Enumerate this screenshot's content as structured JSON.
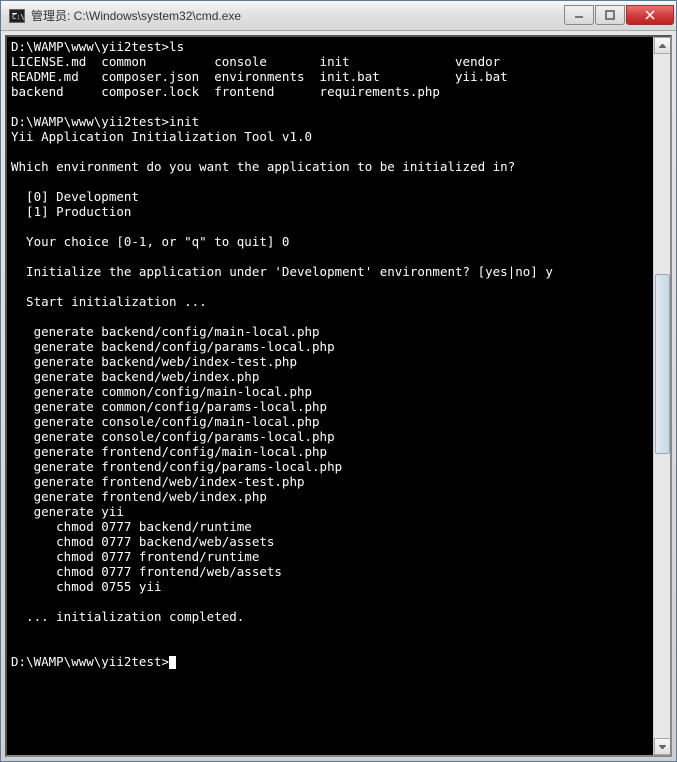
{
  "window": {
    "title": "管理员: C:\\Windows\\system32\\cmd.exe"
  },
  "terminal": {
    "lines": [
      "D:\\WAMP\\www\\yii2test>ls",
      "LICENSE.md  common         console       init              vendor",
      "README.md   composer.json  environments  init.bat          yii.bat",
      "backend     composer.lock  frontend      requirements.php",
      "",
      "D:\\WAMP\\www\\yii2test>init",
      "Yii Application Initialization Tool v1.0",
      "",
      "Which environment do you want the application to be initialized in?",
      "",
      "  [0] Development",
      "  [1] Production",
      "",
      "  Your choice [0-1, or \"q\" to quit] 0",
      "",
      "  Initialize the application under 'Development' environment? [yes|no] y",
      "",
      "  Start initialization ...",
      "",
      "   generate backend/config/main-local.php",
      "   generate backend/config/params-local.php",
      "   generate backend/web/index-test.php",
      "   generate backend/web/index.php",
      "   generate common/config/main-local.php",
      "   generate common/config/params-local.php",
      "   generate console/config/main-local.php",
      "   generate console/config/params-local.php",
      "   generate frontend/config/main-local.php",
      "   generate frontend/config/params-local.php",
      "   generate frontend/web/index-test.php",
      "   generate frontend/web/index.php",
      "   generate yii",
      "      chmod 0777 backend/runtime",
      "      chmod 0777 backend/web/assets",
      "      chmod 0777 frontend/runtime",
      "      chmod 0777 frontend/web/assets",
      "      chmod 0755 yii",
      "",
      "  ... initialization completed.",
      "",
      "",
      "D:\\WAMP\\www\\yii2test>"
    ]
  }
}
